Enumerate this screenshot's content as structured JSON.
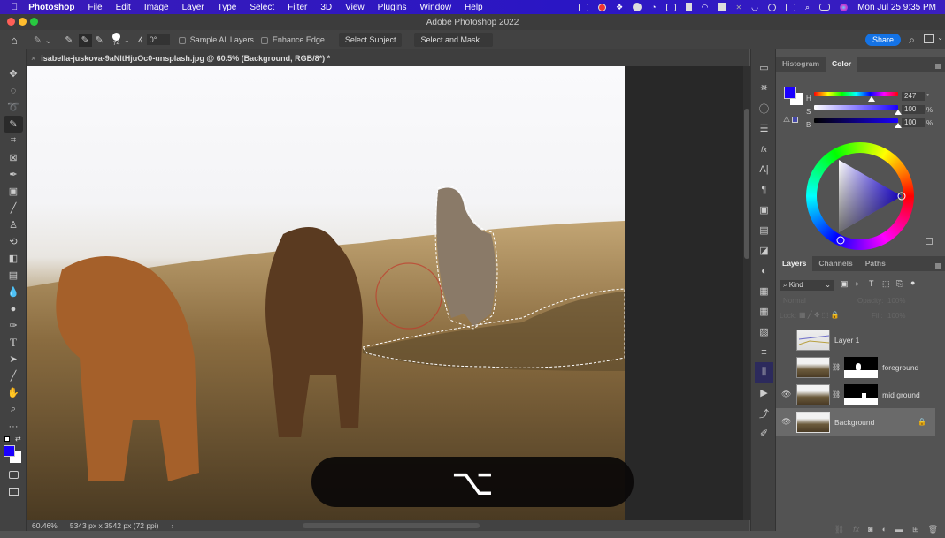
{
  "menubar": {
    "apple": "",
    "app_name": "Photoshop",
    "items": [
      "File",
      "Edit",
      "Image",
      "Layer",
      "Type",
      "Select",
      "Filter",
      "3D",
      "View",
      "Plugins",
      "Window",
      "Help"
    ],
    "clock": "Mon Jul 25  9:35 PM"
  },
  "window": {
    "title": "Adobe Photoshop 2022"
  },
  "options_bar": {
    "brush_size": "74",
    "angle": "0°",
    "sample_all_layers": "Sample All Layers",
    "enhance_edge": "Enhance Edge",
    "select_subject": "Select Subject",
    "select_and_mask": "Select and Mask...",
    "share": "Share"
  },
  "document_tab": {
    "close": "×",
    "title": "isabella-juskova-9aNltHjuOc0-unsplash.jpg @ 60.5% (Background, RGB/8*) *"
  },
  "tools": [
    {
      "name": "move-tool",
      "glyph": "✥"
    },
    {
      "name": "marquee-tool",
      "glyph": "◌"
    },
    {
      "name": "lasso-tool",
      "glyph": "➰"
    },
    {
      "name": "quick-selection-tool",
      "glyph": "✎"
    },
    {
      "name": "crop-tool",
      "glyph": "⌗"
    },
    {
      "name": "frame-tool",
      "glyph": "⊠"
    },
    {
      "name": "eyedropper-tool",
      "glyph": "✒"
    },
    {
      "name": "spot-healing-tool",
      "glyph": "▣"
    },
    {
      "name": "brush-tool",
      "glyph": "╱"
    },
    {
      "name": "clone-stamp-tool",
      "glyph": "♙"
    },
    {
      "name": "history-brush-tool",
      "glyph": "⟲"
    },
    {
      "name": "eraser-tool",
      "glyph": "◧"
    },
    {
      "name": "gradient-tool",
      "glyph": "▤"
    },
    {
      "name": "blur-tool",
      "glyph": "💧"
    },
    {
      "name": "dodge-tool",
      "glyph": "●"
    },
    {
      "name": "pen-tool",
      "glyph": "✑"
    },
    {
      "name": "type-tool",
      "glyph": "T"
    },
    {
      "name": "path-selection-tool",
      "glyph": "➤"
    },
    {
      "name": "line-tool",
      "glyph": "╱"
    },
    {
      "name": "hand-tool",
      "glyph": "✋"
    },
    {
      "name": "zoom-tool",
      "glyph": "⌕"
    },
    {
      "name": "more-tools",
      "glyph": "···"
    }
  ],
  "status_bar": {
    "zoom": "60.46%",
    "doc_size": "5343 px x 3542 px (72 ppi)",
    "arrow": "›"
  },
  "key_hud": {
    "symbol": "⌥"
  },
  "color_panel": {
    "tabs": [
      "Histogram",
      "Color"
    ],
    "active_tab": "Color",
    "foreground": "#1a00ff",
    "background": "#ffffff",
    "h_label": "H",
    "s_label": "S",
    "b_label": "B",
    "h_value": "247",
    "s_value": "100",
    "b_value": "100",
    "h_unit": "°",
    "s_unit": "%",
    "b_unit": "%",
    "h_fraction": 0.686,
    "s_fraction": 1.0,
    "b_fraction": 1.0
  },
  "layers_panel": {
    "tabs": [
      "Layers",
      "Channels",
      "Paths"
    ],
    "active_tab": "Layers",
    "filter_kind": "Kind",
    "blend_mode": "Normal",
    "opacity_label": "Opacity:",
    "opacity_value": "100%",
    "lock_label": "Lock:",
    "fill_label": "Fill:",
    "fill_value": "100%",
    "layers": [
      {
        "name": "Layer 1",
        "visible": false,
        "has_mask": false,
        "selected": false,
        "locked": false
      },
      {
        "name": "foreground",
        "visible": false,
        "has_mask": true,
        "selected": false,
        "locked": false
      },
      {
        "name": "mid ground",
        "visible": true,
        "has_mask": true,
        "selected": false,
        "locked": false
      },
      {
        "name": "Background",
        "visible": true,
        "has_mask": false,
        "selected": true,
        "locked": true
      }
    ]
  }
}
